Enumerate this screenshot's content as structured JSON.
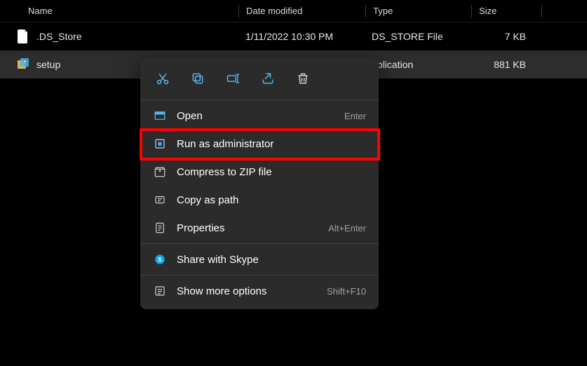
{
  "columns": {
    "name": "Name",
    "date": "Date modified",
    "type": "Type",
    "size": "Size"
  },
  "rows": [
    {
      "name": ".DS_Store",
      "date": "1/11/2022 10:30 PM",
      "type": "DS_STORE File",
      "size": "7 KB"
    },
    {
      "name": "setup",
      "date": "",
      "type": "pplication",
      "size": "881 KB"
    }
  ],
  "toolbar_icons": [
    "cut",
    "copy",
    "rename",
    "share",
    "delete"
  ],
  "menu": {
    "open": {
      "label": "Open",
      "shortcut": "Enter"
    },
    "runas": {
      "label": "Run as administrator",
      "shortcut": ""
    },
    "compress": {
      "label": "Compress to ZIP file",
      "shortcut": ""
    },
    "copypath": {
      "label": "Copy as path",
      "shortcut": ""
    },
    "properties": {
      "label": "Properties",
      "shortcut": "Alt+Enter"
    },
    "skype": {
      "label": "Share with Skype",
      "shortcut": ""
    },
    "more": {
      "label": "Show more options",
      "shortcut": "Shift+F10"
    }
  }
}
